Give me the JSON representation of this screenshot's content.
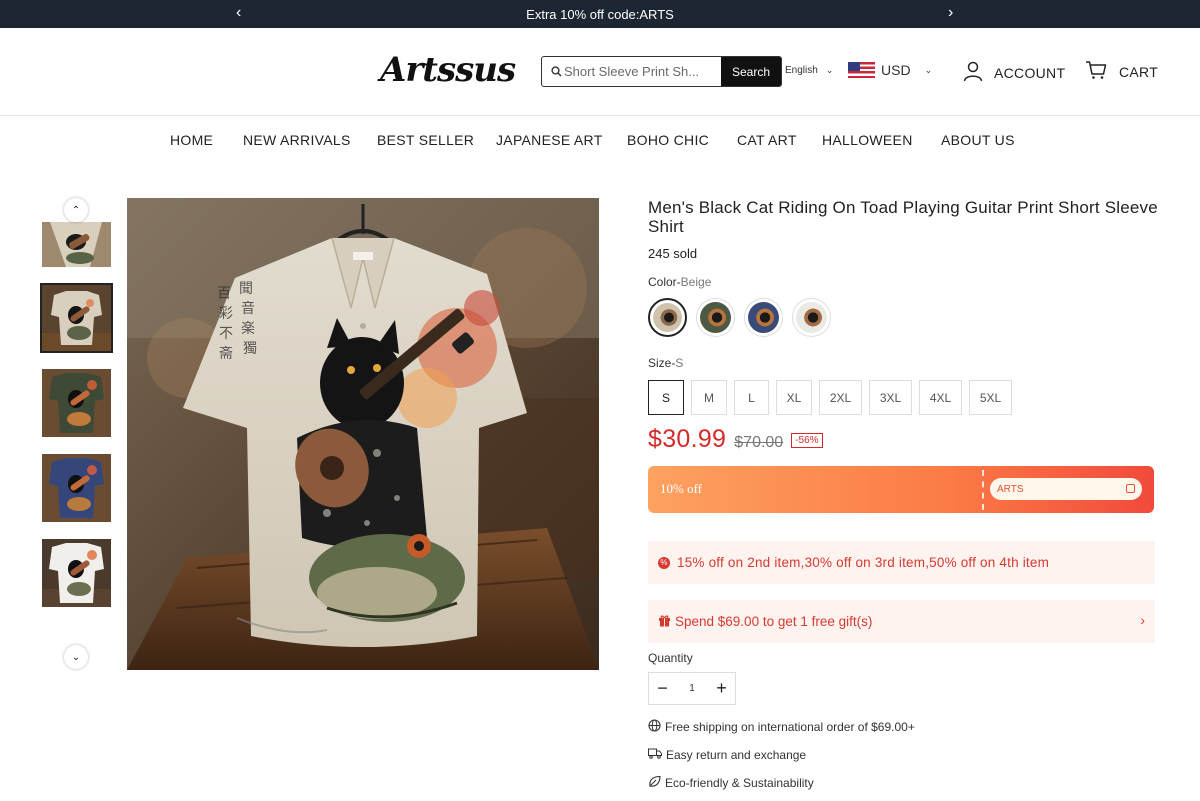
{
  "announcement": {
    "text": "Extra 10% off code:ARTS",
    "prev": "‹",
    "next": "›"
  },
  "header": {
    "logo": "Artssus",
    "search": {
      "placeholder": "Short Sleeve Print Sh...",
      "button": "Search"
    },
    "language": "English",
    "currency": "USD",
    "account": "ACCOUNT",
    "cart": "CART"
  },
  "nav": [
    "HOME",
    "NEW ARRIVALS",
    "BEST SELLER",
    "JAPANESE ART",
    "BOHO CHIC",
    "CAT ART",
    "HALLOWEEN",
    "ABOUT US"
  ],
  "thumbnails": [
    {
      "color": "partial",
      "selected": false
    },
    {
      "color": "beige",
      "selected": true
    },
    {
      "color": "green",
      "selected": false
    },
    {
      "color": "navy",
      "selected": false
    },
    {
      "color": "white",
      "selected": false
    }
  ],
  "product": {
    "title": "Men's Black Cat Riding On Toad Playing Guitar Print Short Sleeve Shirt",
    "sold": "245 sold",
    "color_label": "Color-",
    "color_value": "Beige",
    "swatches": [
      {
        "name": "Beige",
        "hex": "#cfc3ad",
        "selected": true
      },
      {
        "name": "Green",
        "hex": "#4c5a44",
        "selected": false
      },
      {
        "name": "Navy",
        "hex": "#3a4b7a",
        "selected": false
      },
      {
        "name": "White",
        "hex": "#ebe9e4",
        "selected": false
      }
    ],
    "size_label": "Size-",
    "size_value": "S",
    "sizes": [
      "S",
      "M",
      "L",
      "XL",
      "2XL",
      "3XL",
      "4XL",
      "5XL"
    ],
    "selected_size": "S",
    "price": "$30.99",
    "original_price": "$70.00",
    "discount": "-56%",
    "coupon": {
      "label": "10% off",
      "code": "ARTS"
    },
    "promo": "15% off on 2nd item,30% off on 3rd item,50% off on 4th item",
    "gift": "Spend $69.00 to get 1 free gift(s)",
    "quantity_label": "Quantity",
    "quantity": "1",
    "features": [
      "Free shipping on international order of $69.00+",
      "Easy return and exchange",
      "Eco-friendly & Sustainability"
    ]
  },
  "colors": {
    "accent": "#d52a2a",
    "announce_bg": "#1d2733",
    "coupon_start": "#fda260",
    "coupon_end": "#f14a3c",
    "promo_bg": "#fff3f0"
  }
}
